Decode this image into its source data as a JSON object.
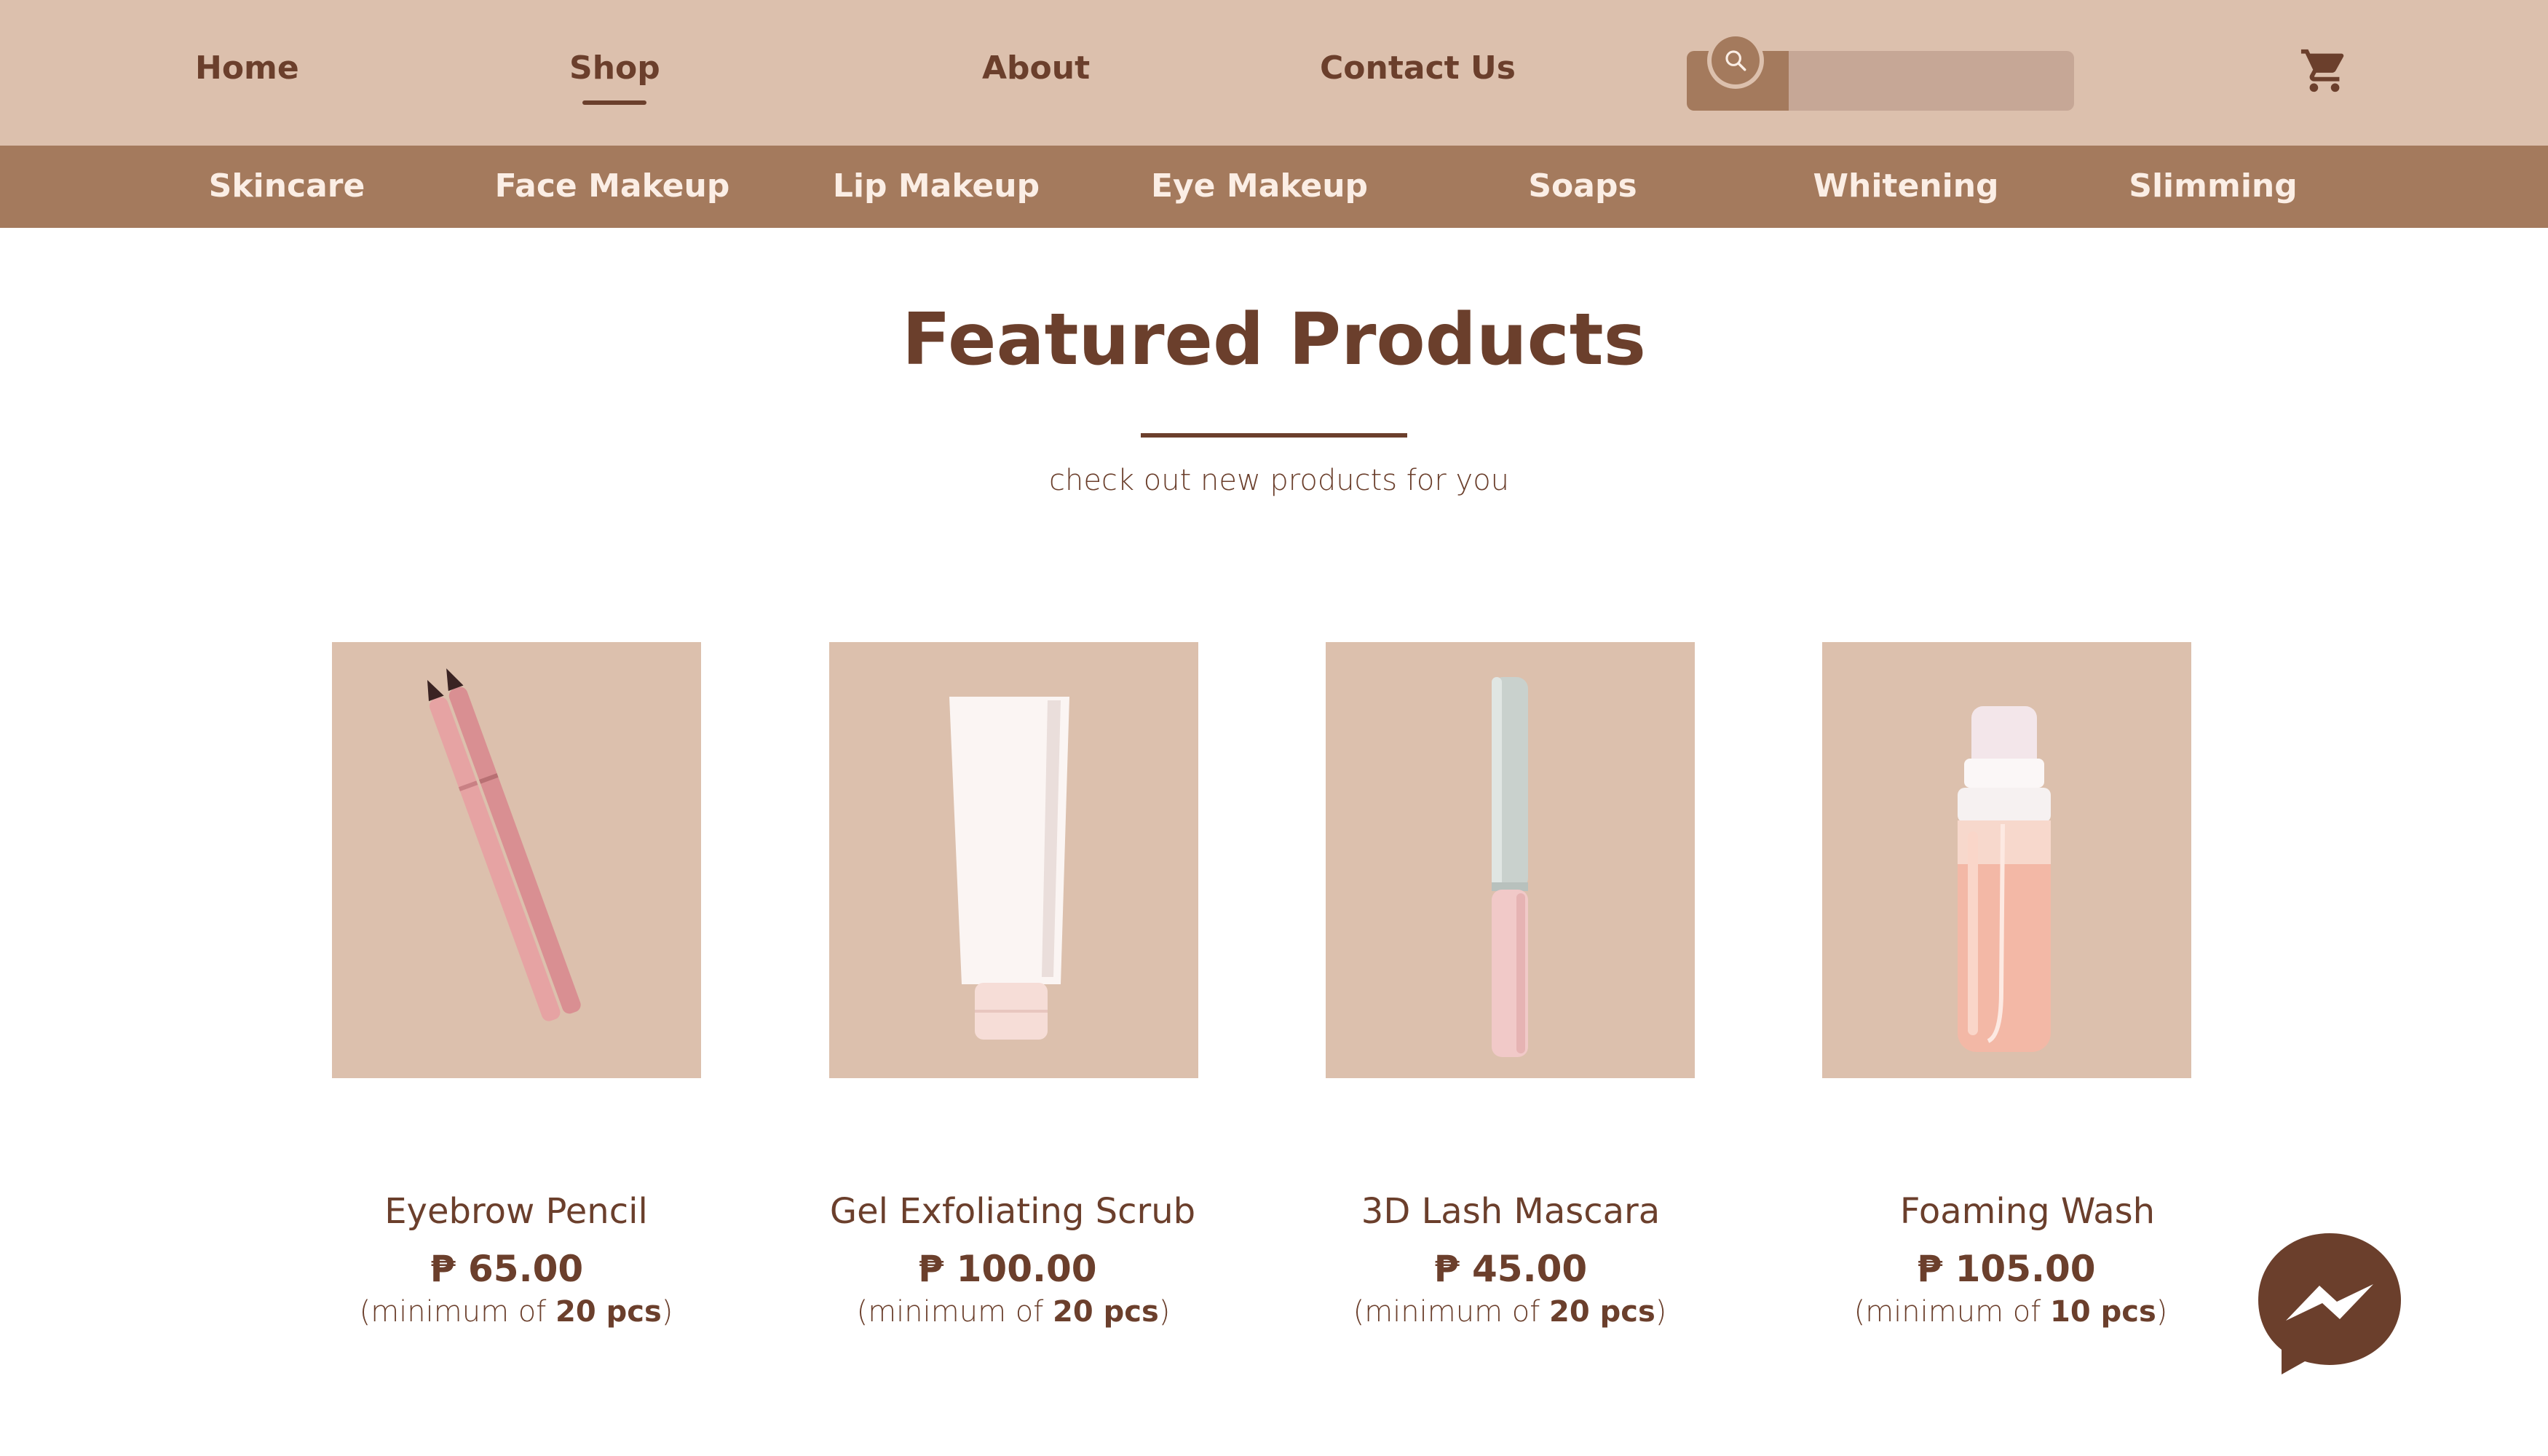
{
  "nav": {
    "home": "Home",
    "shop": "Shop",
    "about": "About",
    "contact": "Contact Us",
    "search_placeholder": "",
    "active": "Shop"
  },
  "categories": [
    "Skincare",
    "Face Makeup",
    "Lip Makeup",
    "Eye Makeup",
    "Soaps",
    "Whitening",
    "Slimming"
  ],
  "featured": {
    "title": "Featured Products",
    "subtitle": "check out new products for you"
  },
  "products": [
    {
      "name": "Eyebrow Pencil",
      "price": "₱ 65.00",
      "min_prefix": "(minimum of ",
      "min_qty": "20 pcs",
      "min_suffix": ")"
    },
    {
      "name": "Gel Exfoliating Scrub",
      "price": "₱ 100.00",
      "min_prefix": "(minimum of ",
      "min_qty": "20 pcs",
      "min_suffix": ")"
    },
    {
      "name": "3D Lash Mascara",
      "price": "₱ 45.00",
      "min_prefix": "(minimum of ",
      "min_qty": "20 pcs",
      "min_suffix": ")"
    },
    {
      "name": "Foaming Wash",
      "price": "₱ 105.00",
      "min_prefix": "(minimum of ",
      "min_qty": "10 pcs",
      "min_suffix": ")"
    }
  ],
  "colors": {
    "nav_bg": "#dcc0ad",
    "category_bg": "#a47a5d",
    "text_brown": "#6b3f2c",
    "card_bg": "#dcc0ad",
    "search_field": "#c6a796"
  },
  "icons": {
    "search": "search-icon",
    "cart": "cart-icon",
    "messenger": "messenger-icon"
  }
}
